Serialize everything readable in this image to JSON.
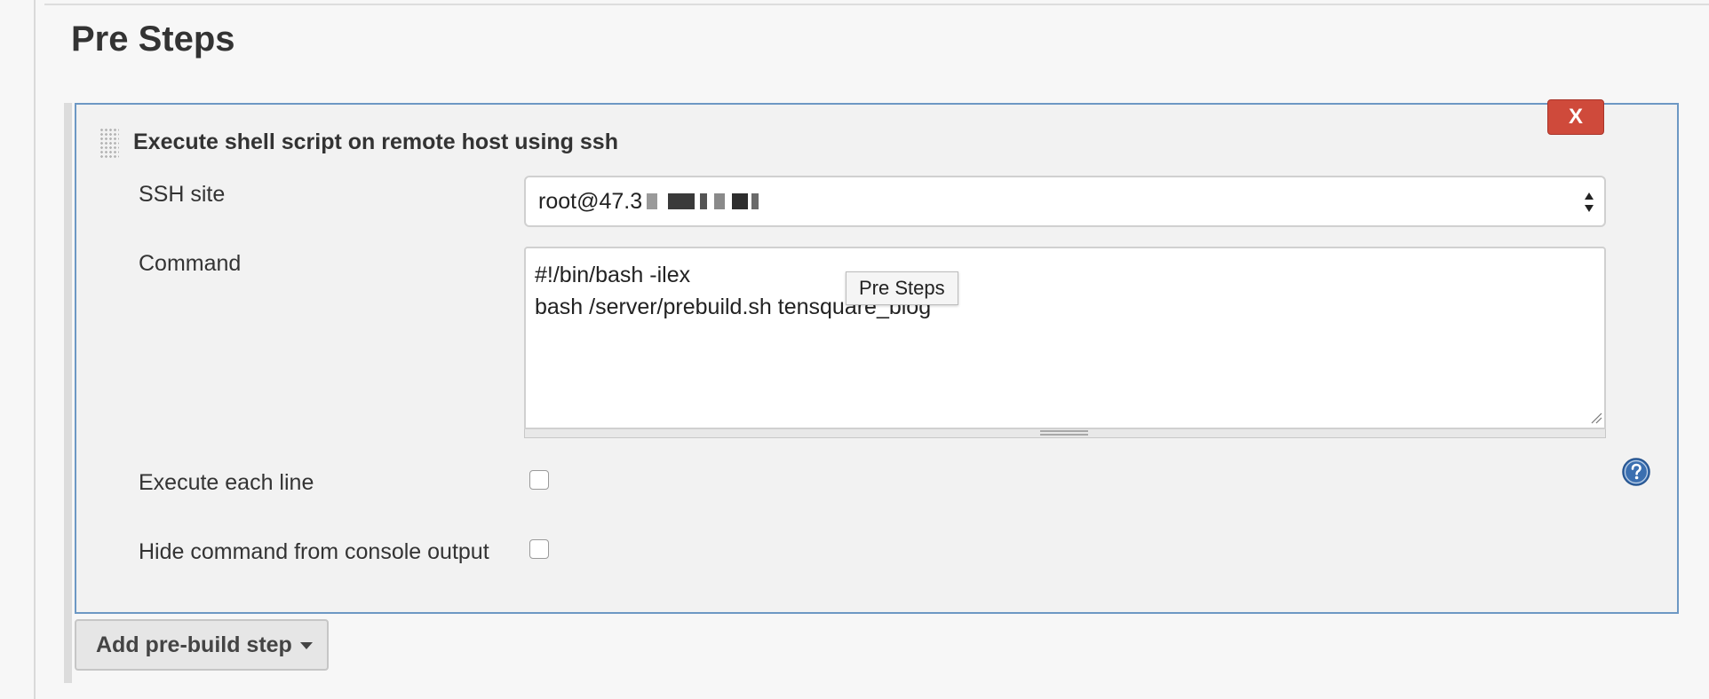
{
  "section": {
    "title": "Pre Steps"
  },
  "step": {
    "title": "Execute shell script on remote host using ssh",
    "delete_label": "X",
    "ssh_site": {
      "label": "SSH site",
      "value": "root@47.3"
    },
    "command": {
      "label": "Command",
      "value": "#!/bin/bash -ilex\nbash /server/prebuild.sh tensquare_blog"
    },
    "execute_each_line": {
      "label": "Execute each line",
      "checked": false
    },
    "hide_command": {
      "label": "Hide command from console output",
      "checked": false
    }
  },
  "tooltip": {
    "text": "Pre Steps"
  },
  "add_step_button": {
    "label": "Add pre-build step"
  },
  "colors": {
    "panel_border": "#6d98c4",
    "delete_red": "#cf4a3b",
    "help_blue": "#3b6fb0"
  },
  "icons": {
    "grip": "drag-handle-icon",
    "delete": "close-icon",
    "select": "select-arrows-icon",
    "help": "help-icon",
    "caret": "caret-down-icon"
  }
}
